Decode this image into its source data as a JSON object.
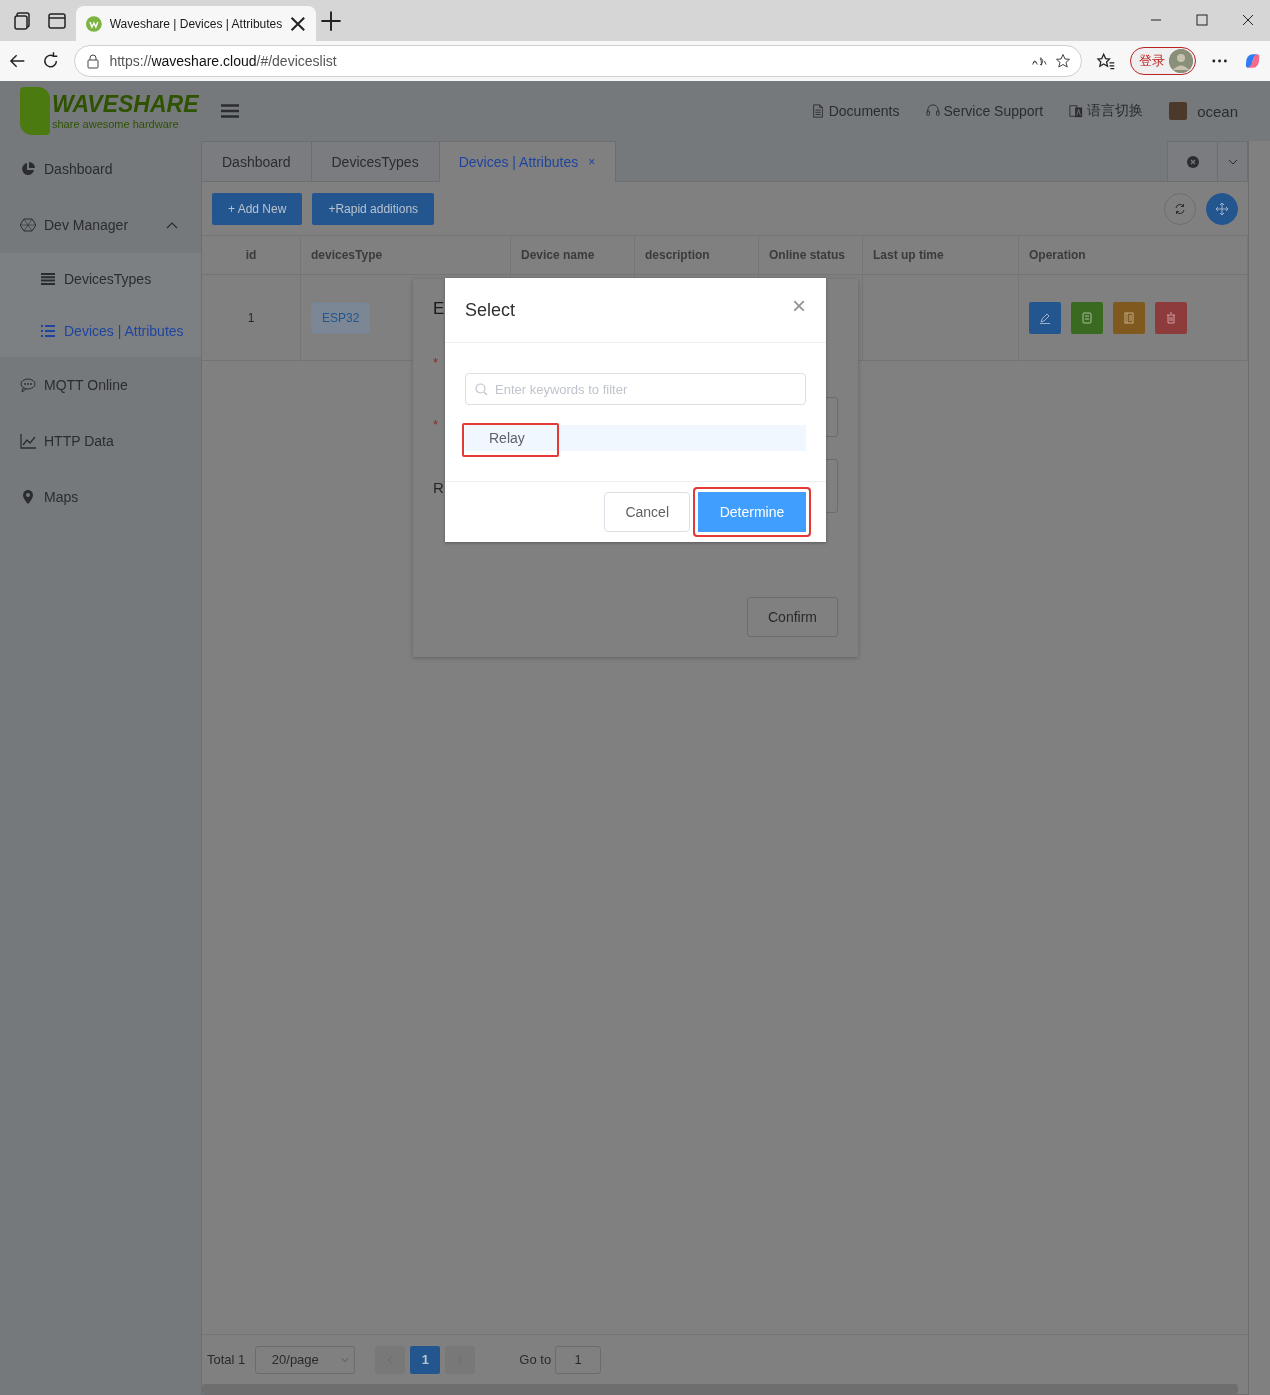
{
  "browser": {
    "tab_title": "Waveshare | Devices | Attributes",
    "url_scheme": "https://",
    "url_host": "waveshare.cloud",
    "url_path": "/#/deviceslist",
    "signin": "登录"
  },
  "logo": {
    "name": "WAVESHARE",
    "tagline": "share awesome hardware"
  },
  "sidebar": {
    "items": [
      {
        "label": "Dashboard",
        "selected": false
      },
      {
        "label": "Dev Manager",
        "selected": false,
        "expanded": true,
        "children": [
          {
            "label": "DevicesTypes",
            "selected": false
          },
          {
            "label": "Devices | Attributes",
            "selected": true
          }
        ]
      },
      {
        "label": "MQTT Online",
        "selected": false
      },
      {
        "label": "HTTP Data",
        "selected": false
      },
      {
        "label": "Maps",
        "selected": false
      }
    ]
  },
  "header": {
    "links": [
      {
        "label": "Documents"
      },
      {
        "label": "Service Support"
      },
      {
        "label": "语言切换"
      }
    ],
    "user": "ocean"
  },
  "tabs": [
    {
      "label": "Dashboard",
      "selected": false,
      "closable": false
    },
    {
      "label": "DevicesTypes",
      "selected": false,
      "closable": false
    },
    {
      "label": "Devices | Attributes",
      "selected": true,
      "closable": true
    }
  ],
  "tab_close": "×",
  "toolbar": {
    "buttons": [
      "+ Add New",
      "+Rapid additions"
    ]
  },
  "table": {
    "columns": [
      "id",
      "devicesType",
      "Device name",
      "description",
      "Online status",
      "Last up time",
      "Operation"
    ],
    "rows": [
      {
        "id": "1",
        "devices_type": "ESP32",
        "operations": [
          {
            "kind": "edit",
            "color": "#23558f"
          },
          {
            "kind": "data",
            "color": "#3a6a1f"
          },
          {
            "kind": "log",
            "color": "#80591f"
          },
          {
            "kind": "delete",
            "color": "#8e3b3b"
          }
        ]
      }
    ]
  },
  "pagination": {
    "total": "Total 1",
    "page_size": "20/page",
    "pages": [
      {
        "label": "1",
        "selected": true
      }
    ],
    "goto_label": "Go to",
    "goto_value": "1"
  },
  "edit_dialog": {
    "title": "E",
    "rows": [
      {
        "kind": "label",
        "mark": "*"
      },
      {
        "kind": "input",
        "mark": "*"
      },
      {
        "kind": "textarea",
        "label": "R"
      }
    ],
    "confirm": "Confirm"
  },
  "select_dialog": {
    "title": "Select",
    "close": "×",
    "search_placeholder": "Enter keywords to filter",
    "items": [
      {
        "label": "Relay",
        "selected": true,
        "highlighted": true
      }
    ],
    "buttons": [
      {
        "label": "Cancel",
        "kind": "default",
        "highlighted": false
      },
      {
        "label": "Determine",
        "kind": "primary",
        "highlighted": true
      }
    ]
  }
}
